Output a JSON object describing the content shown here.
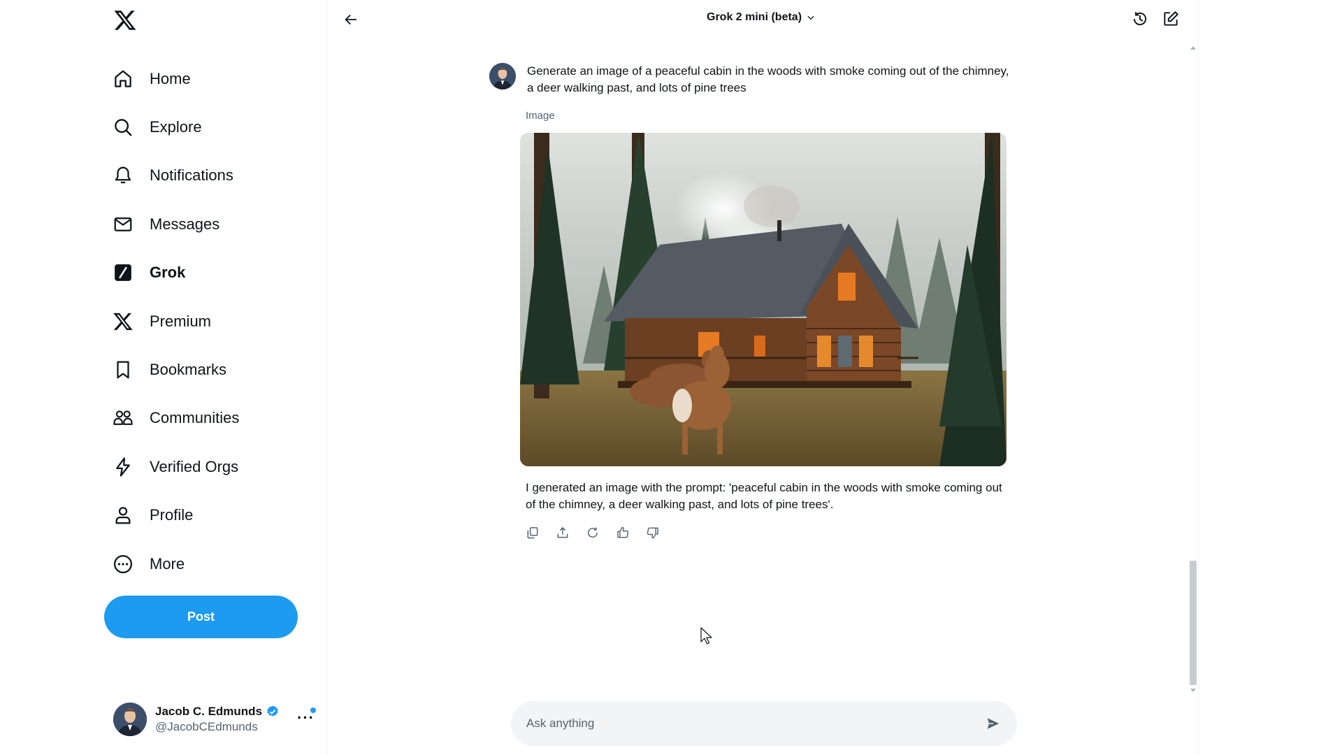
{
  "sidebar": {
    "items": [
      {
        "label": "Home",
        "icon": "home-icon"
      },
      {
        "label": "Explore",
        "icon": "search-icon"
      },
      {
        "label": "Notifications",
        "icon": "bell-icon"
      },
      {
        "label": "Messages",
        "icon": "envelope-icon"
      },
      {
        "label": "Grok",
        "icon": "grok-icon"
      },
      {
        "label": "Premium",
        "icon": "x-logo-icon"
      },
      {
        "label": "Bookmarks",
        "icon": "bookmark-icon"
      },
      {
        "label": "Communities",
        "icon": "people-icon"
      },
      {
        "label": "Verified Orgs",
        "icon": "lightning-icon"
      },
      {
        "label": "Profile",
        "icon": "person-icon"
      },
      {
        "label": "More",
        "icon": "more-circle-icon"
      }
    ],
    "post_label": "Post",
    "account": {
      "name": "Jacob C. Edmunds",
      "handle": "@JacobCEdmunds"
    }
  },
  "header": {
    "model": "Grok 2 mini (beta)"
  },
  "chat": {
    "user_prompt": "Generate an image of a peaceful cabin in the woods with smoke coming out of the chimney, a deer walking past, and lots of pine trees",
    "image_label": "Image",
    "reply": "I generated an image with the prompt: 'peaceful cabin in the woods with smoke coming out of the chimney, a deer walking past, and lots of pine trees'."
  },
  "composer": {
    "placeholder": "Ask anything"
  },
  "colors": {
    "accent": "#1d9bf0",
    "text": "#0f1419",
    "muted": "#536471"
  }
}
